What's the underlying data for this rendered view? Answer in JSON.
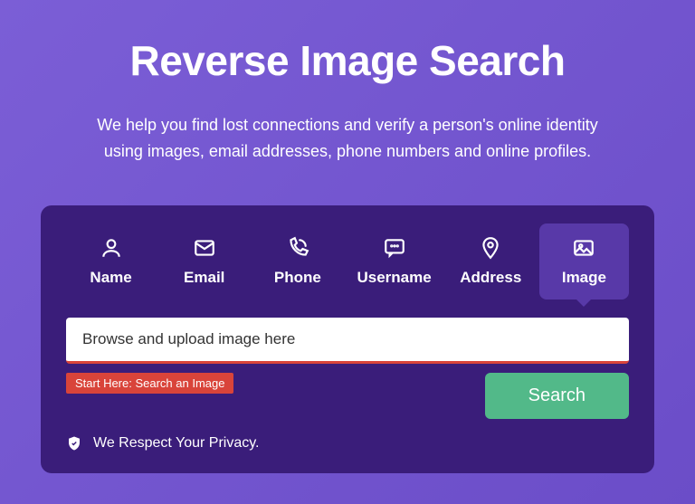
{
  "header": {
    "title": "Reverse Image Search",
    "subtitle": "We help you find lost connections and verify a person's online identity using images, email addresses, phone numbers and online profiles."
  },
  "tabs": {
    "name": "Name",
    "email": "Email",
    "phone": "Phone",
    "username": "Username",
    "address": "Address",
    "image": "Image"
  },
  "search": {
    "placeholder": "Browse and upload image here",
    "hint": "Start Here: Search an Image",
    "button": "Search"
  },
  "privacy": {
    "text": "We Respect Your Privacy."
  }
}
